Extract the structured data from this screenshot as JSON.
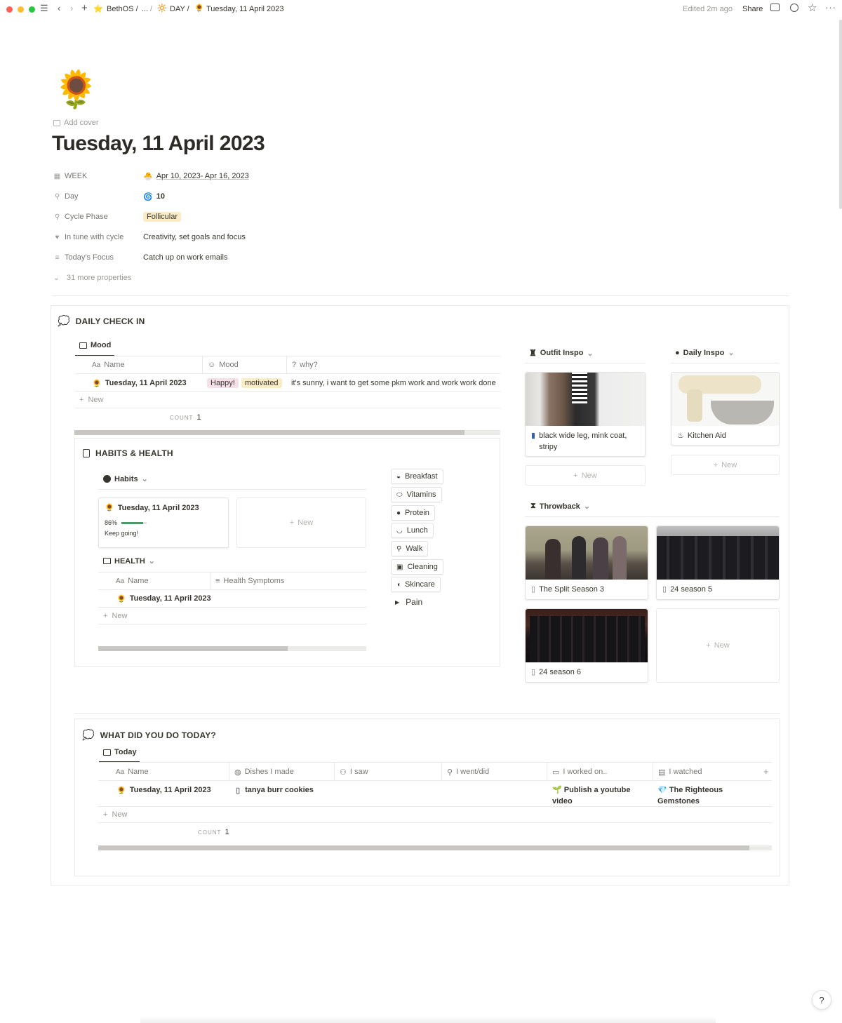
{
  "topbar": {
    "breadcrumb": [
      "BethOS /",
      "...",
      "/",
      "DAY /",
      "Tuesday, 11 April 2023"
    ],
    "edited": "Edited 2m ago",
    "share": "Share"
  },
  "page": {
    "emoji": "🌻",
    "add_cover": "Add cover",
    "title": "Tuesday, 11 April 2023"
  },
  "properties": [
    {
      "label": "WEEK",
      "value": "Apr 10, 2023- Apr 16, 2023",
      "icon": "calendar-icon"
    },
    {
      "label": "Day",
      "value": "10",
      "icon": "bike-icon"
    },
    {
      "label": "Cycle Phase",
      "value": "Follicular",
      "icon": "bike-icon"
    },
    {
      "label": "In tune with cycle",
      "value": "Creativity, set goals and focus",
      "icon": "heart-icon"
    },
    {
      "label": "Today's Focus",
      "value": "Catch up on work emails",
      "icon": "lines-icon"
    }
  ],
  "more_properties": "31 more properties",
  "checkin": {
    "title": "DAILY CHECK IN",
    "view": "Mood",
    "columns": [
      "Name",
      "Mood",
      "why?"
    ],
    "row": {
      "name": "Tuesday, 11 April 2023",
      "moods": [
        "Happy!",
        "motivated"
      ],
      "why": "it's sunny, i want to get some pkm work and work work done"
    },
    "new": "New",
    "count_label": "COUNT",
    "count": "1"
  },
  "habits": {
    "title": "HABITS & HEALTH",
    "view": "Habits",
    "card_title": "Tuesday, 11 April 2023",
    "percent": "86%",
    "progress": 0.86,
    "message": "Keep going!",
    "new": "New",
    "health_view": "HEALTH",
    "health_columns": [
      "Name",
      "Health Symptoms"
    ],
    "health_row": "Tuesday, 11 April 2023",
    "health_new": "New",
    "chips": [
      "Breakfast",
      "Vitamins",
      "Protein",
      "Lunch",
      "Walk",
      "Cleaning",
      "Skincare"
    ],
    "toggle": "Pain"
  },
  "outfit": {
    "title": "Outfit Inspo",
    "card": "black wide leg, mink coat, stripy",
    "new": "New"
  },
  "daily_inspo": {
    "title": "Daily Inspo",
    "card": "Kitchen Aid",
    "new": "New"
  },
  "throwback": {
    "title": "Throwback",
    "cards": [
      "The Split Season 3",
      "24 season 5",
      "24 season 6"
    ],
    "new": "New"
  },
  "today": {
    "title": "WHAT DID YOU DO TODAY?",
    "view": "Today",
    "columns": [
      "Name",
      "Dishes I made",
      "I saw",
      "I went/did",
      "I worked on..",
      "I watched"
    ],
    "row": {
      "name": "Tuesday, 11 April 2023",
      "dish": "tanya burr cookies",
      "worked": "Publish a youtube video",
      "watched": "The Righteous Gemstones"
    },
    "new": "New",
    "count_label": "COUNT",
    "count": "1"
  },
  "colors": {
    "happy_bg": "#f5e0e9",
    "motivated_bg": "#fbecc8",
    "follicular_bg": "#fbecc8",
    "progress": "#4f9768"
  },
  "help": "?"
}
